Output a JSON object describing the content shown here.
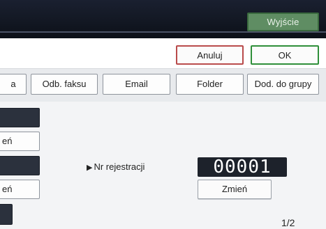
{
  "header": {
    "exit_label": "Wyjście"
  },
  "actions": {
    "cancel_label": "Anuluj",
    "ok_label": "OK"
  },
  "tabs": [
    {
      "label": "a"
    },
    {
      "label": "Odb. faksu"
    },
    {
      "label": "Email"
    },
    {
      "label": "Folder"
    },
    {
      "label": "Dod. do grupy"
    }
  ],
  "left_panel": {
    "change_label_1": "eń",
    "change_label_2": "eń"
  },
  "registration": {
    "label": "Nr rejestracji",
    "number": "00001",
    "change_label": "Zmień"
  },
  "pagination": {
    "text": "1/2"
  }
}
